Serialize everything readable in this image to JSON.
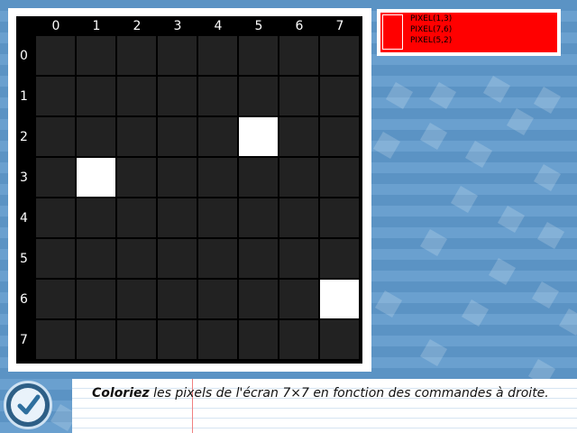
{
  "grid": {
    "columns": [
      "0",
      "1",
      "2",
      "3",
      "4",
      "5",
      "6",
      "7"
    ],
    "rows": [
      "0",
      "1",
      "2",
      "3",
      "4",
      "5",
      "6",
      "7"
    ],
    "lit_pixels": [
      [
        5,
        2
      ],
      [
        1,
        3
      ],
      [
        7,
        6
      ]
    ]
  },
  "commands": {
    "lines": [
      "PIXEL(1,3)",
      "PIXEL(7,6)",
      "PIXEL(5,2)"
    ]
  },
  "instruction": {
    "bold": "Coloriez",
    "rest": " les pixels de l'écran 7×7 en fonction des commandes à droite."
  },
  "colors": {
    "cell_off": "#222222",
    "cell_on": "#ffffff",
    "command_panel": "#ff0000",
    "background": "#5b93c4"
  },
  "icons": {
    "validate": "check-icon"
  }
}
